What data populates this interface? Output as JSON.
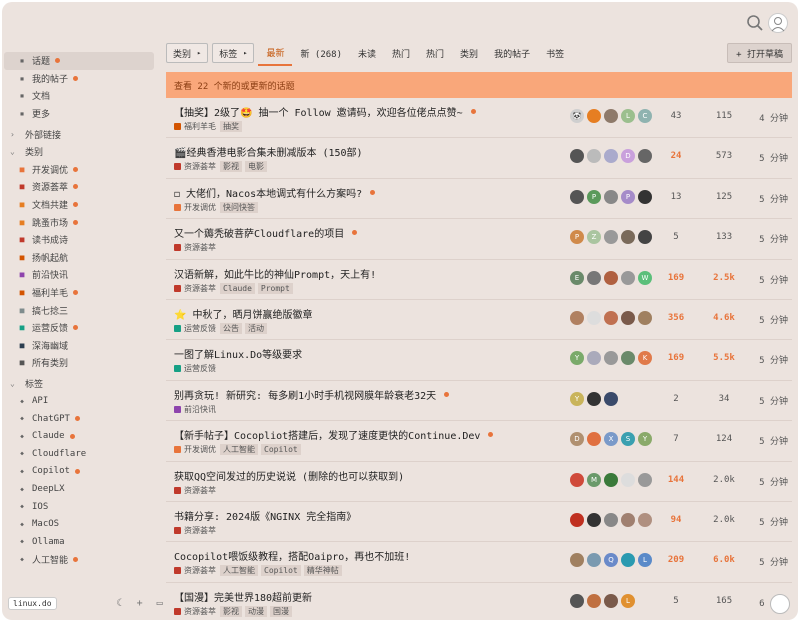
{
  "header": {
    "search_icon": "search-icon",
    "user_avatar": "user-avatar"
  },
  "sidebar": {
    "items": [
      {
        "label": "话题",
        "icon": "layers-icon",
        "dot": true,
        "active": true
      },
      {
        "label": "我的帖子",
        "icon": "user-icon",
        "dot": true
      },
      {
        "label": "文档",
        "icon": "doc-icon",
        "dot": false
      },
      {
        "label": "更多",
        "icon": "more-icon",
        "dot": false
      }
    ],
    "links_section": "外部链接",
    "categories_section": "类别",
    "categories": [
      {
        "label": "开发调优",
        "color": "#e8743b",
        "dot": true
      },
      {
        "label": "资源荟萃",
        "color": "#c0392b",
        "dot": true
      },
      {
        "label": "文档共建",
        "color": "#e67e22",
        "dot": true
      },
      {
        "label": "跳蚤市场",
        "color": "#e67e22",
        "dot": true
      },
      {
        "label": "读书成诗",
        "color": "#c0392b",
        "dot": false
      },
      {
        "label": "扬帆起航",
        "color": "#d35400",
        "dot": false
      },
      {
        "label": "前沿快讯",
        "color": "#8e44ad",
        "dot": false
      },
      {
        "label": "福利羊毛",
        "color": "#d35400",
        "dot": true
      },
      {
        "label": "搞七捻三",
        "color": "#7f8c8d",
        "dot": false
      },
      {
        "label": "运营反馈",
        "color": "#16a085",
        "dot": true
      },
      {
        "label": "深海幽域",
        "color": "#2c3e50",
        "dot": false
      },
      {
        "label": "所有类别",
        "color": "#555555",
        "dot": false
      }
    ],
    "tags_section": "标签",
    "tags": [
      {
        "label": "API",
        "dot": false
      },
      {
        "label": "ChatGPT",
        "dot": true
      },
      {
        "label": "Claude",
        "dot": true
      },
      {
        "label": "Cloudflare",
        "dot": false
      },
      {
        "label": "Copilot",
        "dot": true
      },
      {
        "label": "DeepLX",
        "dot": false
      },
      {
        "label": "IOS",
        "dot": false
      },
      {
        "label": "MacOS",
        "dot": false
      },
      {
        "label": "Ollama",
        "dot": false
      },
      {
        "label": "人工智能",
        "dot": true
      }
    ],
    "footer": {
      "domain": "linux.do"
    }
  },
  "nav": {
    "categories_dropdown": "类别",
    "tags_dropdown": "标签",
    "tabs": [
      {
        "label": "最新",
        "active": true
      },
      {
        "label": "新 (268)"
      },
      {
        "label": "未读"
      },
      {
        "label": "热门"
      },
      {
        "label": "热门"
      },
      {
        "label": "类别"
      },
      {
        "label": "我的帖子"
      },
      {
        "label": "书签"
      }
    ],
    "new_topic": "+ 打开草稿"
  },
  "banner": "查看 22 个新的或更新的话题",
  "topics": [
    {
      "title": "【抽奖】2级了🤩 抽一个 Follow 邀请码，欢迎各位佬点点赞~",
      "unread": true,
      "category": "福利羊毛",
      "cat_color": "#d35400",
      "tags": [
        "抽奖"
      ],
      "avatars": [
        [
          "#cfcfcf",
          "🐼"
        ],
        [
          "#e67e22",
          ""
        ],
        [
          "#8e7a6a",
          ""
        ],
        [
          "#9bbf8e",
          "L"
        ],
        [
          "#8fb3b0",
          "C"
        ]
      ],
      "replies": "43",
      "views": "115",
      "activity": "4 分钟",
      "hot_r": false,
      "hot_v": false
    },
    {
      "title": "🎬经典香港电影合集未删减版本 (150部)",
      "unread": false,
      "category": "资源荟萃",
      "cat_color": "#c0392b",
      "tags": [
        "影视",
        "电影"
      ],
      "avatars": [
        [
          "#555",
          ""
        ],
        [
          "#bbb",
          ""
        ],
        [
          "#aac",
          ""
        ],
        [
          "#c9a0dc",
          "D"
        ],
        [
          "#666",
          ""
        ]
      ],
      "replies": "24",
      "views": "573",
      "activity": "5 分钟",
      "hot_r": true,
      "hot_v": false
    },
    {
      "title": "◻ 大佬们，Nacos本地调式有什么方案吗?",
      "unread": true,
      "category": "开发调优",
      "cat_color": "#e8743b",
      "tags": [
        "快问快答"
      ],
      "avatars": [
        [
          "#555",
          ""
        ],
        [
          "#5b9a5b",
          "P"
        ],
        [
          "#888",
          ""
        ],
        [
          "#a58bc9",
          "P"
        ],
        [
          "#333",
          ""
        ]
      ],
      "replies": "13",
      "views": "125",
      "activity": "5 分钟",
      "hot_r": false,
      "hot_v": false
    },
    {
      "title": "又一个薅秃破菩萨Cloudflare的项目",
      "unread": true,
      "category": "资源荟萃",
      "cat_color": "#c0392b",
      "tags": [],
      "avatars": [
        [
          "#d08a4a",
          "P"
        ],
        [
          "#aac5a0",
          "Z"
        ],
        [
          "#999",
          ""
        ],
        [
          "#7a6a5a",
          ""
        ],
        [
          "#444",
          ""
        ]
      ],
      "replies": "5",
      "views": "133",
      "activity": "5 分钟",
      "hot_r": false,
      "hot_v": false
    },
    {
      "title": "汉语新解，如此牛比的神仙Prompt，天上有!",
      "unread": false,
      "category": "资源荟萃",
      "cat_color": "#c0392b",
      "tags": [
        "Claude",
        "Prompt"
      ],
      "avatars": [
        [
          "#6a8a6a",
          "E"
        ],
        [
          "#777",
          ""
        ],
        [
          "#b06040",
          ""
        ],
        [
          "#999",
          ""
        ],
        [
          "#5bbf7a",
          "W"
        ]
      ],
      "replies": "169",
      "views": "2.5k",
      "activity": "5 分钟",
      "hot_r": true,
      "hot_v": true
    },
    {
      "title": "⭐ 中秋了，晒月饼赢绝版徽章",
      "unread": false,
      "category": "运营反馈",
      "cat_color": "#16a085",
      "tags": [
        "公告",
        "活动"
      ],
      "avatars": [
        [
          "#b08060",
          ""
        ],
        [
          "#ddd",
          ""
        ],
        [
          "#c07050",
          ""
        ],
        [
          "#7a5a4a",
          ""
        ],
        [
          "#a08060",
          ""
        ]
      ],
      "replies": "356",
      "views": "4.6k",
      "activity": "5 分钟",
      "hot_r": true,
      "hot_v": true
    },
    {
      "title": "一图了解Linux.Do等级要求",
      "unread": false,
      "category": "运营反馈",
      "cat_color": "#16a085",
      "tags": [],
      "avatars": [
        [
          "#7aaa6a",
          "Y"
        ],
        [
          "#aab",
          ""
        ],
        [
          "#999",
          ""
        ],
        [
          "#6a8a6a",
          ""
        ],
        [
          "#e07a4a",
          "K"
        ]
      ],
      "replies": "169",
      "views": "5.5k",
      "activity": "5 分钟",
      "hot_r": true,
      "hot_v": true
    },
    {
      "title": "别再贪玩! 新研究: 每多刷1小时手机视网膜年龄衰老32天",
      "unread": true,
      "category": "前沿快讯",
      "cat_color": "#8e44ad",
      "tags": [],
      "avatars": [
        [
          "#c9b45a",
          "Y"
        ],
        [
          "#333",
          ""
        ],
        [
          "#3a4a6a",
          ""
        ]
      ],
      "replies": "2",
      "views": "34",
      "activity": "5 分钟",
      "hot_r": false,
      "hot_v": false
    },
    {
      "title": "【新手帖子】Cocopliot搭建后，发现了速度更快的Continue.Dev",
      "unread": true,
      "category": "开发调优",
      "cat_color": "#e8743b",
      "tags": [
        "人工智能",
        "Copilot"
      ],
      "avatars": [
        [
          "#b09070",
          "D"
        ],
        [
          "#e07040",
          ""
        ],
        [
          "#7a9ac9",
          "X"
        ],
        [
          "#3aa0b0",
          "S"
        ],
        [
          "#8aaa6a",
          "Y"
        ]
      ],
      "replies": "7",
      "views": "124",
      "activity": "5 分钟",
      "hot_r": false,
      "hot_v": false
    },
    {
      "title": "获取QQ空间发过的历史说说 (删除的也可以获取到)",
      "unread": false,
      "category": "资源荟萃",
      "cat_color": "#c0392b",
      "tags": [],
      "avatars": [
        [
          "#d04a3a",
          ""
        ],
        [
          "#6a9a6a",
          "M"
        ],
        [
          "#3a7a3a",
          ""
        ],
        [
          "#ddd",
          ""
        ],
        [
          "#999",
          ""
        ]
      ],
      "replies": "144",
      "views": "2.0k",
      "activity": "5 分钟",
      "hot_r": true,
      "hot_v": false
    },
    {
      "title": "书籍分享: 2024版《NGINX 完全指南》",
      "unread": false,
      "category": "资源荟萃",
      "cat_color": "#c0392b",
      "tags": [],
      "avatars": [
        [
          "#c03020",
          ""
        ],
        [
          "#333",
          ""
        ],
        [
          "#888",
          ""
        ],
        [
          "#a08070",
          ""
        ],
        [
          "#b09080",
          ""
        ]
      ],
      "replies": "94",
      "views": "2.0k",
      "activity": "5 分钟",
      "hot_r": true,
      "hot_v": false
    },
    {
      "title": "Cocopilot喂饭级教程，搭配Oaipro，再也不加班!",
      "unread": false,
      "category": "资源荟萃",
      "cat_color": "#c0392b",
      "tags": [
        "人工智能",
        "Copilot",
        "精华神帖"
      ],
      "avatars": [
        [
          "#a08060",
          ""
        ],
        [
          "#7a9ab0",
          ""
        ],
        [
          "#6a8ac9",
          "Q"
        ],
        [
          "#2a9ab0",
          ""
        ],
        [
          "#5a8ac9",
          "L"
        ]
      ],
      "replies": "209",
      "views": "6.0k",
      "activity": "5 分钟",
      "hot_r": true,
      "hot_v": true
    },
    {
      "title": "【国漫】完美世界180超前更新",
      "unread": false,
      "category": "资源荟萃",
      "cat_color": "#c0392b",
      "tags": [
        "影视",
        "动漫",
        "国漫"
      ],
      "avatars": [
        [
          "#555",
          ""
        ],
        [
          "#c07040",
          ""
        ],
        [
          "#7a5a4a",
          ""
        ],
        [
          "#e09030",
          "L"
        ]
      ],
      "replies": "5",
      "views": "165",
      "activity": "6 分钟",
      "hot_r": false,
      "hot_v": false
    }
  ]
}
